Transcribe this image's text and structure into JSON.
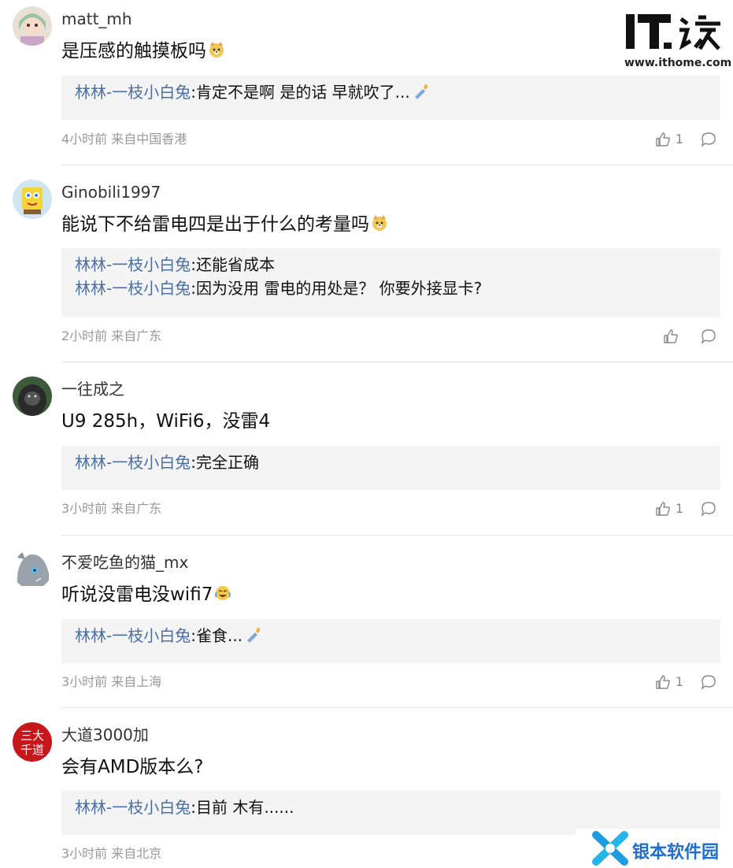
{
  "site": {
    "logo_text": "IT之家",
    "logo_url": "www.ithome.com"
  },
  "comments": [
    {
      "username": "matt_mh",
      "content": "是压感的触摸板吗",
      "emoji": "doge-emoji",
      "replies": [
        {
          "author": "林林-一枝小白兔",
          "sep": ":",
          "text": "肯定不是啊 是的话 早就吹了...",
          "emoji": "candle-emoji"
        }
      ],
      "time": "4小时前",
      "location": "来自中国香港",
      "likes": "1"
    },
    {
      "username": "Ginobili1997",
      "content": "能说下不给雷电四是出于什么的考量吗",
      "emoji": "doge-emoji",
      "replies": [
        {
          "author": "林林-一枝小白兔",
          "sep": ":",
          "text": "还能省成本"
        },
        {
          "author": "林林-一枝小白兔",
          "sep": ":",
          "text": "因为没用 雷电的用处是？ 你要外接显卡?"
        }
      ],
      "time": "2小时前",
      "location": "来自广东",
      "likes": ""
    },
    {
      "username": "一往成之",
      "content": "U9 285h，WiFi6，没雷4",
      "replies": [
        {
          "author": "林林-一枝小白兔",
          "sep": ":",
          "text": "完全正确"
        }
      ],
      "time": "3小时前",
      "location": "来自广东",
      "likes": "1"
    },
    {
      "username": "不爱吃鱼的猫_mx",
      "content": "听说没雷电没wifi7",
      "emoji": "laugh-cry-emoji",
      "replies": [
        {
          "author": "林林-一枝小白兔",
          "sep": ":",
          "text": "雀食...",
          "emoji": "candle-emoji"
        }
      ],
      "time": "3小时前",
      "location": "来自上海",
      "likes": "1"
    },
    {
      "username": "大道3000加",
      "content": "会有AMD版本么?",
      "replies": [
        {
          "author": "林林-一枝小白兔",
          "sep": ":",
          "text": "目前 木有......"
        }
      ],
      "time": "3小时前",
      "location": "来自北京",
      "likes": ""
    }
  ],
  "watermark": {
    "text": "银本软件园"
  },
  "colors": {
    "reply_author": "#4a6fa5",
    "meta": "#999999",
    "reply_bg": "#f4f4f4",
    "watermark": "#1f6fd1"
  }
}
